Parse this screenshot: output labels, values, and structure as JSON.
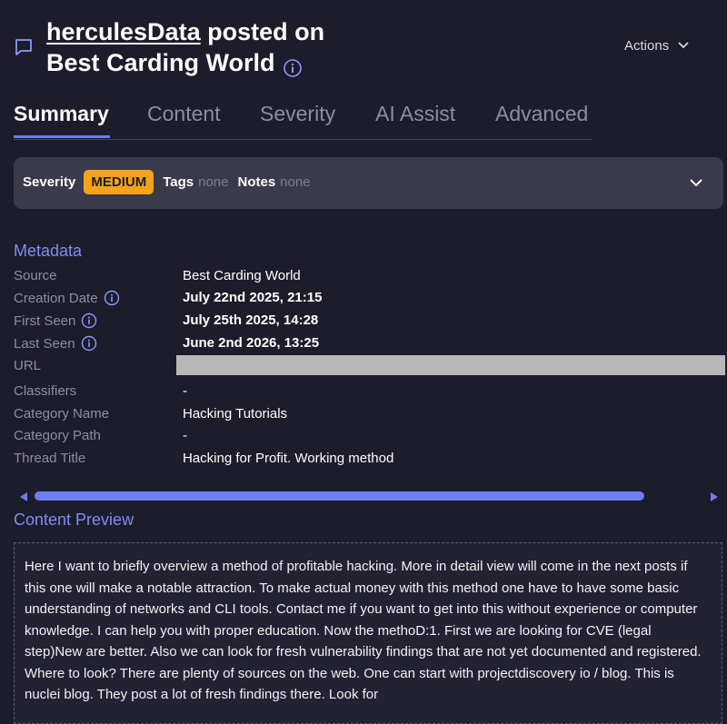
{
  "header": {
    "author": "herculesData",
    "posted_on": " posted on",
    "forum": "Best Carding World",
    "actions_label": "Actions"
  },
  "tabs": [
    {
      "label": "Summary",
      "active": true
    },
    {
      "label": "Content",
      "active": false
    },
    {
      "label": "Severity",
      "active": false
    },
    {
      "label": "AI Assist",
      "active": false
    },
    {
      "label": "Advanced",
      "active": false
    }
  ],
  "severity_bar": {
    "severity_label": "Severity",
    "severity_value": "MEDIUM",
    "tags_label": "Tags",
    "tags_value": "none",
    "notes_label": "Notes",
    "notes_value": "none"
  },
  "metadata": {
    "title": "Metadata",
    "rows": [
      {
        "key": "Source",
        "value": "Best Carding World"
      },
      {
        "key": "Creation Date",
        "value": "July 22nd 2025, 21:15"
      },
      {
        "key": "First Seen",
        "value": "July 25th 2025, 14:28"
      },
      {
        "key": "Last Seen",
        "value": "June 2nd 2026, 13:25"
      },
      {
        "key": "URL",
        "value": ""
      },
      {
        "key": "Classifiers",
        "value": "-"
      },
      {
        "key": "Category Name",
        "value": "Hacking Tutorials"
      },
      {
        "key": "Category Path",
        "value": "-"
      },
      {
        "key": "Thread Title",
        "value": "Hacking for Profit. Working method"
      }
    ]
  },
  "content_preview": {
    "title": "Content Preview",
    "text": "Here I want to briefly overview a method of profitable hacking. More in detail view will come in the next posts if this one will make a notable attraction. To make actual money with this method one have to have some basic understanding of networks and CLI tools. Contact me if you want to get into this without experience or computer knowledge. I can help you with proper education. Now the methoD:1. First we are looking for CVE (legal step)New are better. Also we can look for fresh vulnerability findings that are not yet documented and registered. Where to look? There are plenty of sources on the web. One can start with projectdiscovery io / blog. This is nuclei blog. They post a lot of fresh findings there. Look for"
  },
  "colors": {
    "background": "#1d1c2b",
    "accent": "#6d7ef2",
    "severity_medium": "#f6a21a",
    "panel": "#3a3a4c"
  }
}
